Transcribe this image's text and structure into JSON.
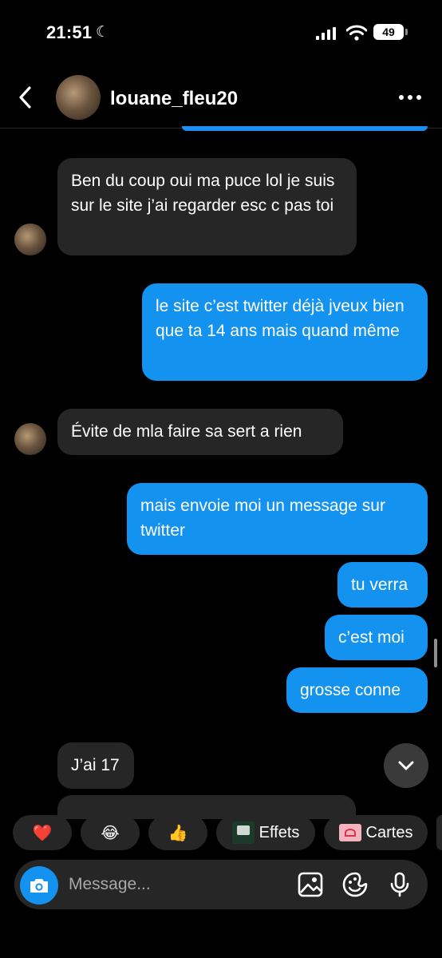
{
  "status_bar": {
    "time": "21:51",
    "battery": "49",
    "icons": [
      "moon-icon",
      "signal-icon",
      "wifi-icon",
      "battery-icon"
    ]
  },
  "header": {
    "username": "louane_fleu20",
    "icons": [
      "chevron-left-icon",
      "more-icon"
    ]
  },
  "messages": [
    {
      "side": "received",
      "text": "Ben du coup oui ma puce lol je suis sur le site j’ai regarder esc c pas toi"
    },
    {
      "side": "sent",
      "text": "le site c’est twitter déjà jveux bien que ta 14 ans mais quand même"
    },
    {
      "side": "received",
      "text": "Évite de mla faire sa sert a rien"
    },
    {
      "side": "sent",
      "text": "mais envoie moi un message sur twitter"
    },
    {
      "side": "sent",
      "text": "tu verra"
    },
    {
      "side": "sent",
      "text": "c’est moi"
    },
    {
      "side": "sent",
      "text": "grosse conne"
    },
    {
      "side": "received",
      "text": "J’ai 17"
    }
  ],
  "quick_reactions": [
    {
      "emoji": "❤️",
      "icon": "heart-icon"
    },
    {
      "emoji": "😂",
      "icon": "laughing-emoji-icon"
    },
    {
      "emoji": "👍",
      "icon": "thumbs-up-icon"
    },
    {
      "label": "Effets",
      "icon": "effects-icon"
    },
    {
      "label": "Cartes",
      "icon": "cards-icon"
    }
  ],
  "composer": {
    "placeholder": "Message...",
    "icons": [
      "camera-icon",
      "gallery-icon",
      "sticker-icon",
      "microphone-icon"
    ]
  },
  "colors": {
    "background": "#000000",
    "sent_bubble": "#1492f0",
    "received_bubble": "#262626"
  }
}
